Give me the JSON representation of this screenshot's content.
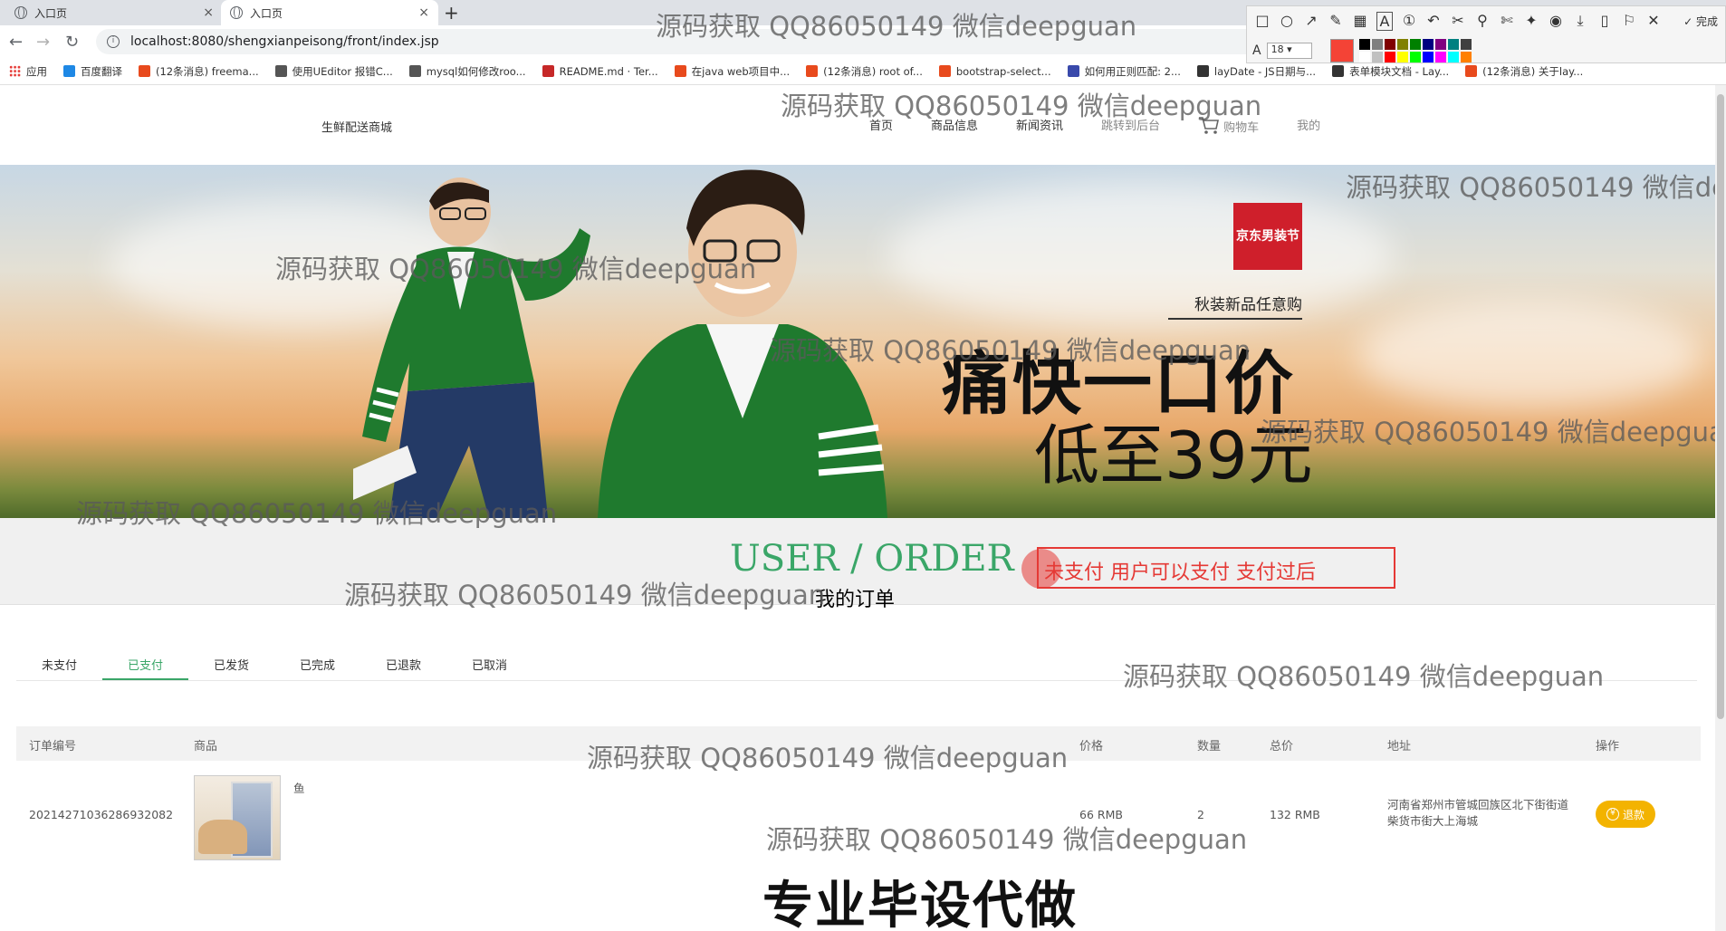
{
  "browser": {
    "tabs": [
      {
        "title": "入口页",
        "close": "×"
      },
      {
        "title": "入口页",
        "close": "×"
      }
    ],
    "new_tab": "+",
    "url": "localhost:8080/shengxianpeisong/front/index.jsp",
    "bookmarks": [
      {
        "label": "应用",
        "color": "#e53935"
      },
      {
        "label": "百度翻译",
        "color": "#1e88e5"
      },
      {
        "label": "(12条消息) freema...",
        "color": "#e84a1d"
      },
      {
        "label": "使用UEditor 报错C...",
        "color": "#555555"
      },
      {
        "label": "mysql如何修改roo...",
        "color": "#555555"
      },
      {
        "label": "README.md · Ter...",
        "color": "#c62828"
      },
      {
        "label": "在java web项目中...",
        "color": "#e84a1d"
      },
      {
        "label": "(12条消息) root of...",
        "color": "#e84a1d"
      },
      {
        "label": "bootstrap-select...",
        "color": "#e84a1d"
      },
      {
        "label": "如何用正则匹配: 2...",
        "color": "#3949ab"
      },
      {
        "label": "layDate - JS日期与...",
        "color": "#333333"
      },
      {
        "label": "表单模块文档 - Lay...",
        "color": "#333333"
      },
      {
        "label": "(12条消息) 关于lay...",
        "color": "#e84a1d"
      }
    ]
  },
  "screenshot_tool": {
    "done_label": "完成",
    "font_size": "18",
    "current_color": "#f44336",
    "palette": [
      "#000000",
      "#808080",
      "#800000",
      "#808000",
      "#008000",
      "#000080",
      "#800080",
      "#008080",
      "#404040",
      "#ffffff",
      "#c0c0c0",
      "#ff0000",
      "#ffff00",
      "#00ff00",
      "#0000ff",
      "#ff00ff",
      "#00ffff",
      "#ff8000"
    ]
  },
  "header": {
    "logo": "生鲜配送商城",
    "nav": [
      {
        "label": "首页",
        "muted": false
      },
      {
        "label": "商品信息",
        "muted": false
      },
      {
        "label": "新闻资讯",
        "muted": false
      },
      {
        "label": "跳转到后台",
        "muted": true
      },
      {
        "label": "购物车",
        "muted": true
      },
      {
        "label": "我的",
        "muted": true
      }
    ]
  },
  "banner": {
    "brand": "京东男装节",
    "tagline": "秋装新品任意购",
    "headline": "痛快一口价",
    "price": "低至39元"
  },
  "section": {
    "title_en": "USER / ORDER",
    "title_cn": "我的订单",
    "annotation": "未支付 用户可以支付  支付过后"
  },
  "order_tabs": [
    {
      "label": "未支付",
      "active": false
    },
    {
      "label": "已支付",
      "active": true
    },
    {
      "label": "已发货",
      "active": false
    },
    {
      "label": "已完成",
      "active": false
    },
    {
      "label": "已退款",
      "active": false
    },
    {
      "label": "已取消",
      "active": false
    }
  ],
  "table": {
    "headers": {
      "order_no": "订单编号",
      "product": "商品",
      "price": "价格",
      "qty": "数量",
      "total": "总价",
      "address": "地址",
      "action": "操作"
    },
    "rows": [
      {
        "order_no": "20214271036286932082",
        "product_name": "鱼",
        "price": "66 RMB",
        "qty": "2",
        "total": "132 RMB",
        "address": "河南省郑州市管城回族区北下街街道柴货市街大上海城",
        "action": "退款"
      }
    ]
  },
  "overlay": {
    "watermark": "源码获取 QQ86050149 微信deepguan",
    "caption": "专业毕设代做"
  }
}
